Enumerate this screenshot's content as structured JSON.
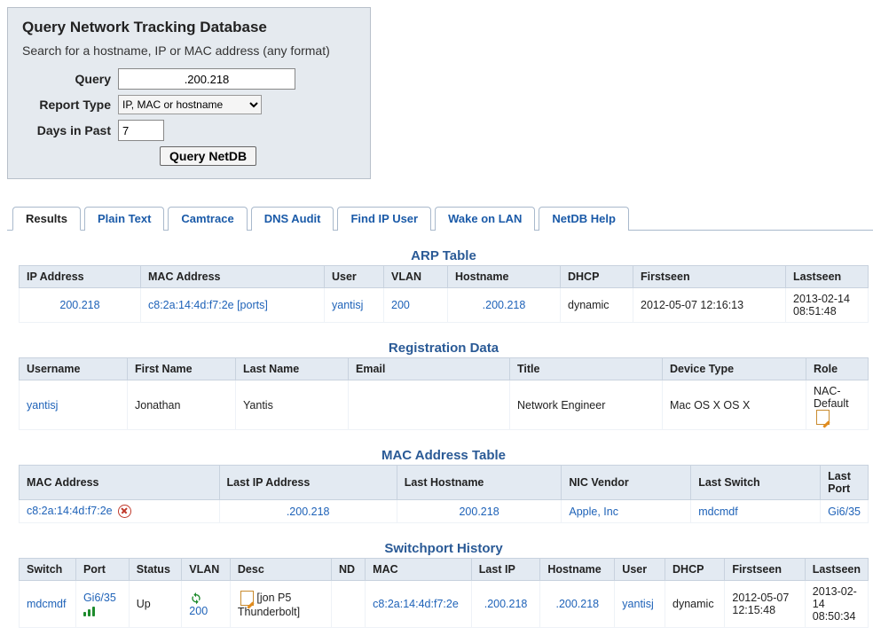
{
  "query_box": {
    "title": "Query Network Tracking Database",
    "subtitle": "Search for a hostname, IP or MAC address (any format)",
    "query_label": "Query",
    "query_value": ".200.218",
    "report_label": "Report Type",
    "report_value": "IP, MAC or hostname",
    "days_label": "Days in Past",
    "days_value": "7",
    "submit": "Query NetDB"
  },
  "tabs": [
    {
      "label": "Results",
      "active": true
    },
    {
      "label": "Plain Text"
    },
    {
      "label": "Camtrace"
    },
    {
      "label": "DNS Audit"
    },
    {
      "label": "Find IP User"
    },
    {
      "label": "Wake on LAN"
    },
    {
      "label": "NetDB Help"
    }
  ],
  "arp": {
    "title": "ARP Table",
    "headers": [
      "IP Address",
      "MAC Address",
      "User",
      "VLAN",
      "Hostname",
      "DHCP",
      "Firstseen",
      "Lastseen"
    ],
    "row": {
      "ip": "200.218",
      "mac": "c8:2a:14:4d:f7:2e [ports]",
      "user": "yantisj",
      "vlan": "200",
      "hostname": ".200.218",
      "dhcp": "dynamic",
      "firstseen": "2012-05-07 12:16:13",
      "lastseen": "2013-02-14 08:51:48"
    }
  },
  "reg": {
    "title": "Registration Data",
    "headers": [
      "Username",
      "First Name",
      "Last Name",
      "Email",
      "Title",
      "Device Type",
      "Role"
    ],
    "row": {
      "username": "yantisj",
      "firstname": "Jonathan",
      "lastname": "Yantis",
      "email": "",
      "title": "Network Engineer",
      "device": "Mac OS X OS X",
      "role": "NAC-Default"
    }
  },
  "mac": {
    "title": "MAC Address Table",
    "headers": [
      "MAC Address",
      "Last IP Address",
      "Last Hostname",
      "NIC Vendor",
      "Last Switch",
      "Last Port"
    ],
    "row": {
      "mac": "c8:2a:14:4d:f7:2e",
      "lastip": ".200.218",
      "lasthost": "200.218",
      "vendor": "Apple, Inc",
      "switch": "mdcmdf",
      "port": "Gi6/35"
    }
  },
  "sw": {
    "title": "Switchport History",
    "headers": [
      "Switch",
      "Port",
      "Status",
      "VLAN",
      "Desc",
      "ND",
      "MAC",
      "Last IP",
      "Hostname",
      "User",
      "DHCP",
      "Firstseen",
      "Lastseen"
    ],
    "row": {
      "switch": "mdcmdf",
      "port": "Gi6/35",
      "status": "Up",
      "vlan": "200",
      "desc": "[jon P5 Thunderbolt]",
      "nd": "",
      "mac": "c8:2a:14:4d:f7:2e",
      "lastip": ".200.218",
      "hostname": ".200.218",
      "user": "yantisj",
      "dhcp": "dynamic",
      "firstseen": "2012-05-07 12:15:48",
      "lastseen": "2013-02-14 08:50:34"
    }
  }
}
